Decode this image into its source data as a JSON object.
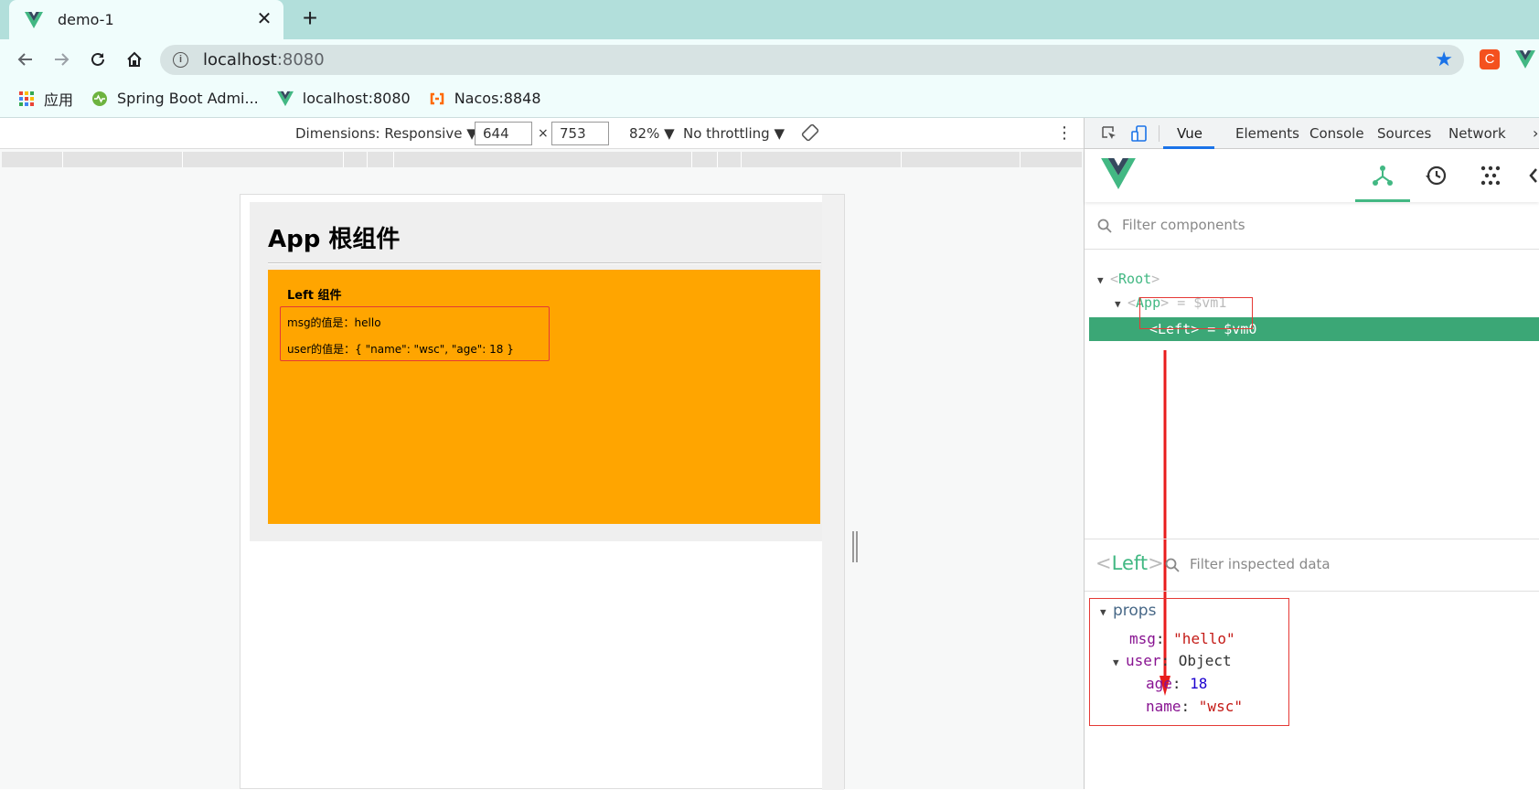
{
  "browser": {
    "tab_title": "demo-1",
    "close_glyph": "✕",
    "new_tab_glyph": "+",
    "url_host": "localhost",
    "url_port": ":8080",
    "star_glyph": "★",
    "ext_c_label": "C"
  },
  "bookmarks": [
    {
      "label": "应用",
      "icon": "apps-grid-icon"
    },
    {
      "label": "Spring Boot Admi...",
      "icon": "spring-boot-admin-icon"
    },
    {
      "label": "localhost:8080",
      "icon": "vue-logo-icon"
    },
    {
      "label": "Nacos:8848",
      "icon": "nacos-icon"
    }
  ],
  "devicebar": {
    "dimensions_label": "Dimensions: Responsive ▼",
    "width": "644",
    "height": "753",
    "times": "×",
    "zoom": "82% ▼",
    "throttling": "No throttling ▼",
    "kebab": "⋮"
  },
  "page": {
    "app_title": "App 根组件",
    "left_title": "Left 组件",
    "msg_line": "msg的值是：hello",
    "user_line": "user的值是：{ \"name\": \"wsc\", \"age\": 18 }"
  },
  "devtools": {
    "tabs": [
      "Vue",
      "Elements",
      "Console",
      "Sources",
      "Network"
    ],
    "more_glyph": "›",
    "filter_placeholder": "Filter components",
    "tree": {
      "root": "Root",
      "app": "App",
      "app_ref": "= $vm1",
      "left": "Left",
      "left_ref": "= $vm0"
    },
    "inspector": {
      "component": "Left",
      "filter_placeholder": "Filter inspected data",
      "section": "props",
      "msg_key": "msg",
      "msg_value": "\"hello\"",
      "user_key": "user",
      "user_value": "Object",
      "age_key": "age",
      "age_value": "18",
      "name_key": "name",
      "name_value": "\"wsc\""
    }
  },
  "colors": {
    "vue_green": "#42b883",
    "selection": "#3ba776",
    "orange": "#ffa500",
    "annotation_red": "#e53935"
  }
}
